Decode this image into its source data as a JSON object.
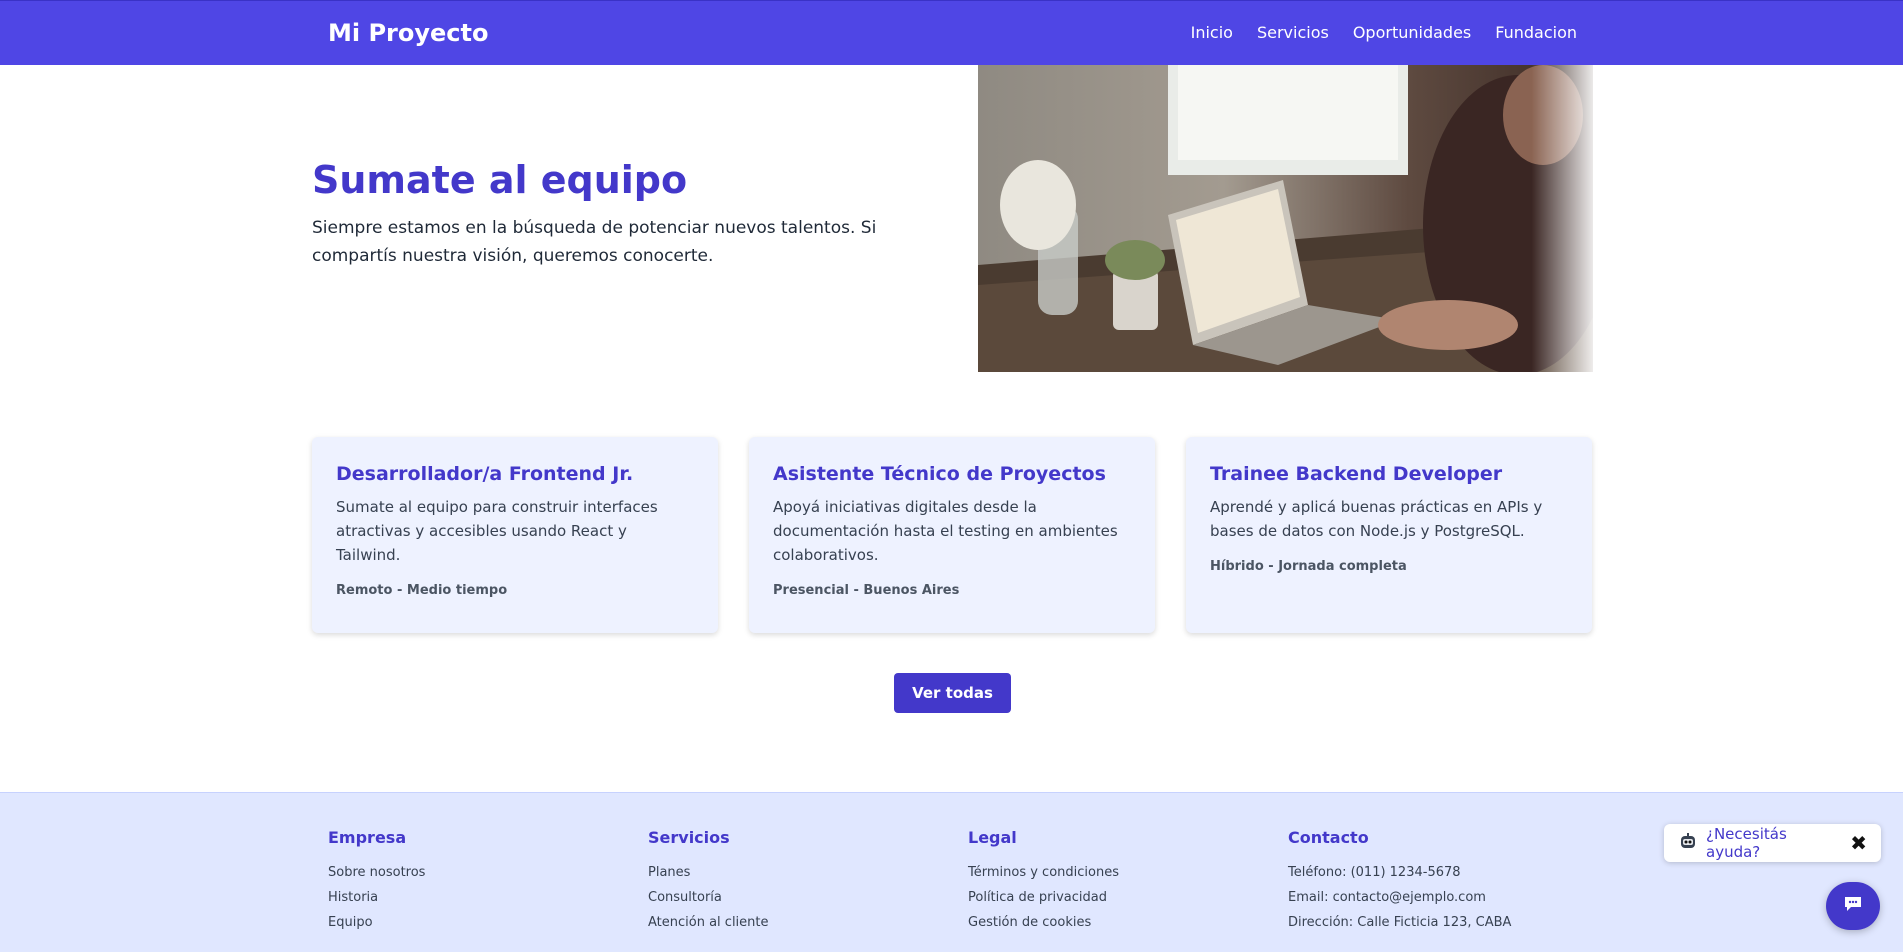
{
  "header": {
    "brand": "Mi Proyecto",
    "nav": [
      "Inicio",
      "Servicios",
      "Oportunidades",
      "Fundacion"
    ]
  },
  "hero": {
    "title": "Sumate al equipo",
    "description": "Siempre estamos en la búsqueda de potenciar nuevos talentos. Si compartís nuestra visión, queremos conocerte."
  },
  "jobs": [
    {
      "title": "Desarrollador/a Frontend Jr.",
      "description": "Sumate al equipo para construir interfaces atractivas y accesibles usando React y Tailwind.",
      "meta": "Remoto - Medio tiempo"
    },
    {
      "title": "Asistente Técnico de Proyectos",
      "description": "Apoyá iniciativas digitales desde la documentación hasta el testing en ambientes colaborativos.",
      "meta": "Presencial - Buenos Aires"
    },
    {
      "title": "Trainee Backend Developer",
      "description": "Aprendé y aplicá buenas prácticas en APIs y bases de datos con Node.js y PostgreSQL.",
      "meta": "Híbrido - Jornada completa"
    }
  ],
  "cta": {
    "label": "Ver todas"
  },
  "footer": {
    "columns": [
      {
        "title": "Empresa",
        "items": [
          "Sobre nosotros",
          "Historia",
          "Equipo"
        ]
      },
      {
        "title": "Servicios",
        "items": [
          "Planes",
          "Consultoría",
          "Atención al cliente"
        ]
      },
      {
        "title": "Legal",
        "items": [
          "Términos y condiciones",
          "Política de privacidad",
          "Gestión de cookies"
        ]
      },
      {
        "title": "Contacto",
        "items": [
          "Teléfono: (011) 1234-5678",
          "Email: contacto@ejemplo.com",
          "Dirección: Calle Ficticia 123, CABA"
        ]
      }
    ]
  },
  "chat": {
    "help_text": "¿Necesitás ayuda?",
    "close_glyph": "✖",
    "bot_icon": "robot-face-icon"
  },
  "colors": {
    "primary": "#4f46e5",
    "primary_dark": "#4338ca",
    "card_bg": "#eef2ff",
    "footer_bg": "#e0e7ff"
  }
}
